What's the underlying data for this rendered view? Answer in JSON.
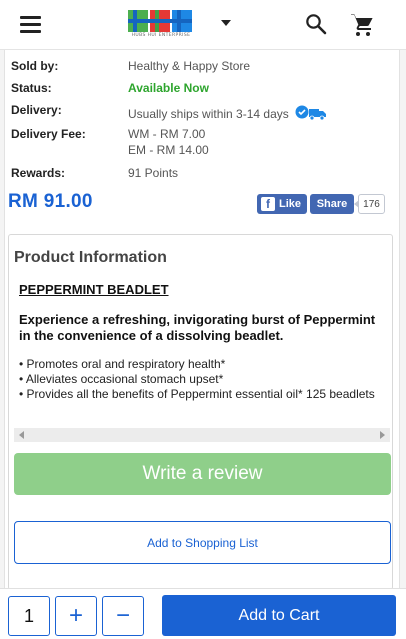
{
  "header": {
    "logo_text": "HUBS HUI ENTERPRISE",
    "menu_icon": "hamburger-icon",
    "search_icon": "search-icon",
    "cart_icon": "cart-icon"
  },
  "details": {
    "sold_by_label": "Sold by:",
    "sold_by_value": "Healthy & Happy Store",
    "status_label": "Status:",
    "status_value": "Available Now",
    "delivery_label": "Delivery:",
    "delivery_value": "Usually ships within 3-14 days",
    "fee_label": "Delivery Fee:",
    "fee_wm": "WM - RM 7.00",
    "fee_em": "EM - RM 14.00",
    "rewards_label": "Rewards:",
    "rewards_value": "91 Points"
  },
  "price": "RM 91.00",
  "facebook": {
    "like_label": "Like",
    "share_label": "Share",
    "count": "176"
  },
  "product_info": {
    "title": "Product Information",
    "name": "PEPPERMINT BEADLET",
    "lead": "Experience a refreshing, invigorating burst of Peppermint in the convenience of a dissolving beadlet.",
    "bullets": [
      "• Promotes oral and respiratory health*",
      "• Alleviates occasional stomach upset*",
      "• Provides all the benefits of Peppermint essential oil* 125 beadlets"
    ]
  },
  "buttons": {
    "write_review": "Write a review",
    "add_to_shopping_list": "Add to Shopping List",
    "add_to_cart": "Add to Cart",
    "plus": "+",
    "minus": "−"
  },
  "quantity": "1",
  "colors": {
    "accent": "#1a62d3",
    "status_green": "#2ea52e",
    "review_green": "#8fcf8a",
    "facebook": "#4267b2"
  }
}
